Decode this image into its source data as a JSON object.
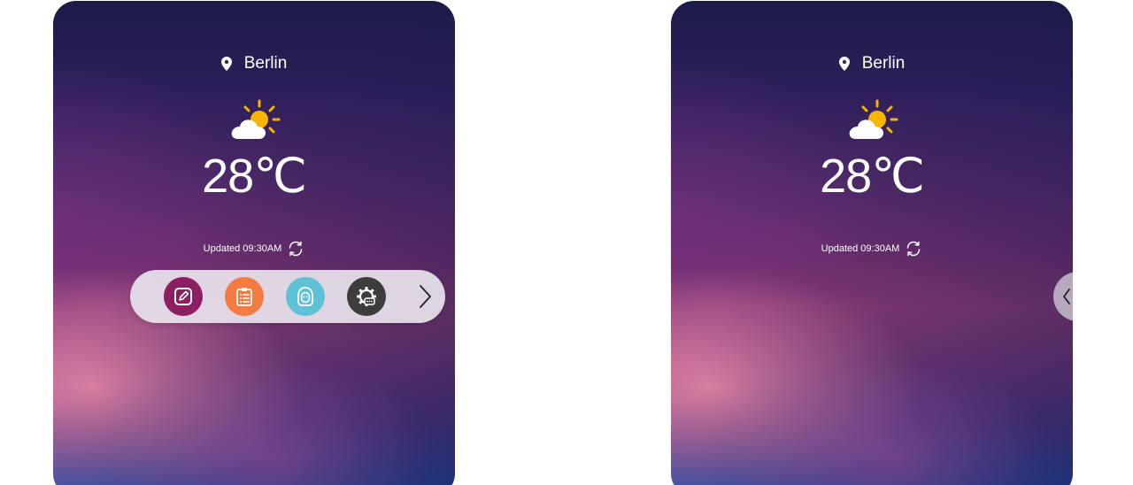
{
  "screens": [
    {
      "location": "Berlin",
      "temperature": "28℃",
      "updated": "Updated 09:30AM",
      "weather_icon": "partly-sunny-icon",
      "dock": {
        "visible": true,
        "apps": [
          {
            "name": "notes-app-icon",
            "color": "#8c1f62"
          },
          {
            "name": "checklist-app-icon",
            "color": "#f47c40"
          },
          {
            "name": "face-app-icon",
            "color": "#5fc1d6"
          },
          {
            "name": "settings-app-icon",
            "color": "#3d3d3d"
          }
        ],
        "next_icon": "chevron-right-icon"
      }
    },
    {
      "location": "Berlin",
      "temperature": "28℃",
      "updated": "Updated 09:30AM",
      "weather_icon": "partly-sunny-icon",
      "dock": {
        "visible": false,
        "collapsed_handle_icon": "chevron-left-icon"
      }
    }
  ],
  "colors": {
    "text": "#ffffff",
    "sun": "#f7b500",
    "cloud": "#ffffff",
    "dock_background": "#e8e2ec"
  }
}
